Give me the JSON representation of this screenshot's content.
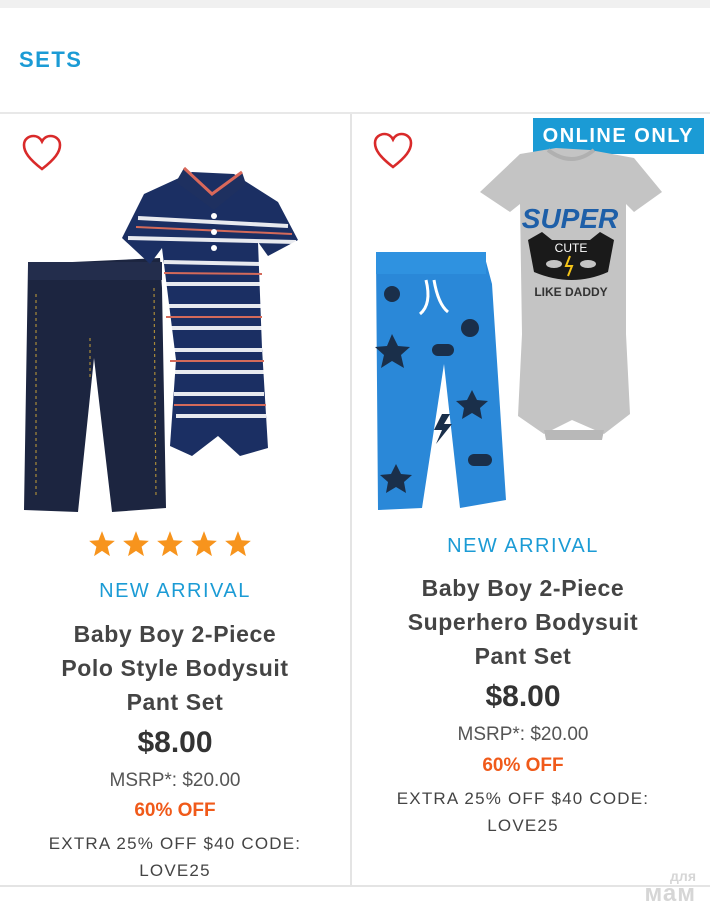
{
  "section": {
    "title": "SETS"
  },
  "products": [
    {
      "rating": 5,
      "badge": "NEW ARRIVAL",
      "title_lines": [
        "Baby Boy 2-Piece",
        "Polo Style Bodysuit",
        "Pant Set"
      ],
      "price": "$8.00",
      "msrp": "MSRP*: $20.00",
      "discount": "60% OFF",
      "promo_lines": [
        "EXTRA 25% OFF $40 CODE:",
        "LOVE25"
      ]
    },
    {
      "corner_badge": "ONLINE ONLY",
      "badge": "NEW ARRIVAL",
      "title_lines": [
        "Baby Boy 2-Piece",
        "Superhero Bodysuit",
        "Pant Set"
      ],
      "price": "$8.00",
      "msrp": "MSRP*: $20.00",
      "discount": "60% OFF",
      "promo_lines": [
        "EXTRA 25% OFF $40 CODE:",
        "LOVE25"
      ],
      "print": {
        "line1": "SUPER",
        "line2": "CUTE",
        "line3": "LIKE DADDY"
      }
    }
  ],
  "watermark": {
    "line1": "для",
    "line2": "мам"
  },
  "colors": {
    "accent": "#1b9bd5",
    "discount": "#f05a1a",
    "star": "#f7941d",
    "heart": "#d92a2a"
  }
}
